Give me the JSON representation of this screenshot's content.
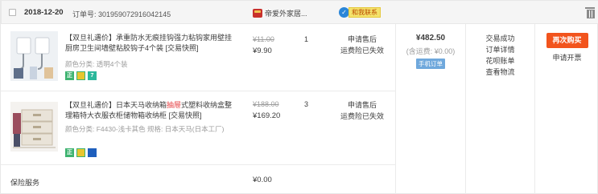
{
  "header": {
    "date": "2018-12-20",
    "order_label": "订单号: 301959072916042145",
    "shop_name": "帝爱外家居...",
    "contact_label": "和我联系"
  },
  "items": [
    {
      "title_pre": "【双旦礼遇价】承重防水无痕挂钩强力粘钩家用壁挂厨房卫生间墙壁粘胶钩子4个装 [交易快照]",
      "title_red": "",
      "title_post": "",
      "sku": "颜色分类: 透明4个装",
      "original_price": "¥11.00",
      "price": "¥9.90",
      "quantity": "1",
      "after_sale": [
        "申请售后",
        "运费险已失效"
      ],
      "badges": [
        "正",
        "",
        "7"
      ]
    },
    {
      "title_pre": "【双旦礼遇价】日本天马收纳箱",
      "title_red": "抽屉",
      "title_post": "式塑料收纳盒整理箱特大衣服衣柜储物箱收纳柜 [交易快照]",
      "sku": "颜色分类: F4430-浅卡其色  规格: 日本天马(日本工厂)",
      "original_price": "¥188.00",
      "price": "¥169.20",
      "quantity": "3",
      "after_sale": [
        "申请售后",
        "运费险已失效"
      ],
      "badges": [
        "正",
        "",
        ""
      ]
    }
  ],
  "insurance": {
    "label": "保险服务",
    "price": "¥0.00"
  },
  "payment": {
    "total": "¥482.50",
    "shipping": "(含运费: ¥0.00)",
    "method": "手机订单"
  },
  "status": [
    "交易成功",
    "订单详情",
    "花呗账单",
    "查看物流"
  ],
  "operations": {
    "rebuy": "再次购买",
    "invoice": "申请开票"
  },
  "colors": {
    "accent": "#f2541d",
    "header_bg": "#f5f5f5",
    "muted": "#9c9c9c"
  }
}
